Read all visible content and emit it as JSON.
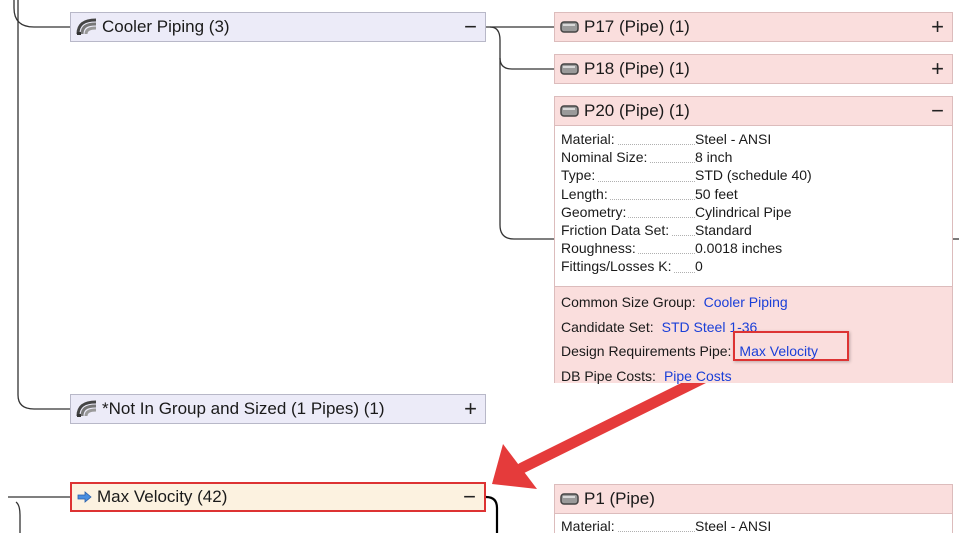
{
  "tree": {
    "cooler_group": {
      "label": "Cooler Piping (3)",
      "toggle": "−",
      "icon": "pipe-group-icon"
    },
    "pipes": [
      {
        "label": "P17 (Pipe) (1)",
        "toggle": "+",
        "icon": "pipe-icon"
      },
      {
        "label": "P18 (Pipe) (1)",
        "toggle": "+",
        "icon": "pipe-icon"
      },
      {
        "label": "P20 (Pipe) (1)",
        "toggle": "−",
        "icon": "pipe-icon"
      }
    ],
    "p20_details": {
      "properties": [
        {
          "key": "Material:",
          "value": "Steel - ANSI"
        },
        {
          "key": "Nominal Size:",
          "value": "8 inch"
        },
        {
          "key": "Type:",
          "value": "STD (schedule 40)"
        },
        {
          "key": "Length:",
          "value": "50 feet"
        },
        {
          "key": "Geometry:",
          "value": "Cylindrical Pipe"
        },
        {
          "key": "Friction Data Set:",
          "value": "Standard"
        },
        {
          "key": "Roughness:",
          "value": "0.0018 inches"
        },
        {
          "key": "Fittings/Losses K:",
          "value": "0"
        }
      ],
      "links": [
        {
          "key": "Common Size Group:",
          "value": "Cooler Piping"
        },
        {
          "key": "Candidate Set:",
          "value": "STD Steel 1-36"
        },
        {
          "key": "Design Requirements Pipe:",
          "value": "Max Velocity"
        },
        {
          "key": "DB Pipe Costs:",
          "value": "Pipe Costs"
        }
      ]
    },
    "not_in_group": {
      "label": "*Not In Group and Sized (1 Pipes) (1)",
      "toggle": "+",
      "icon": "pipe-group-icon"
    },
    "max_velocity": {
      "label": "Max Velocity (42)",
      "toggle": "−",
      "icon": "arrow-right-icon"
    },
    "p1": {
      "label": "P1 (Pipe)",
      "icon": "pipe-icon"
    },
    "p1_details": {
      "key": "Material:",
      "value": "Steel - ANSI"
    }
  },
  "colors": {
    "group_bg": "#ecebf8",
    "pipe_bg": "#fadedd",
    "requirement_bg": "#fcf2e0",
    "highlight": "#dd3333",
    "link": "#1a3fd8"
  }
}
